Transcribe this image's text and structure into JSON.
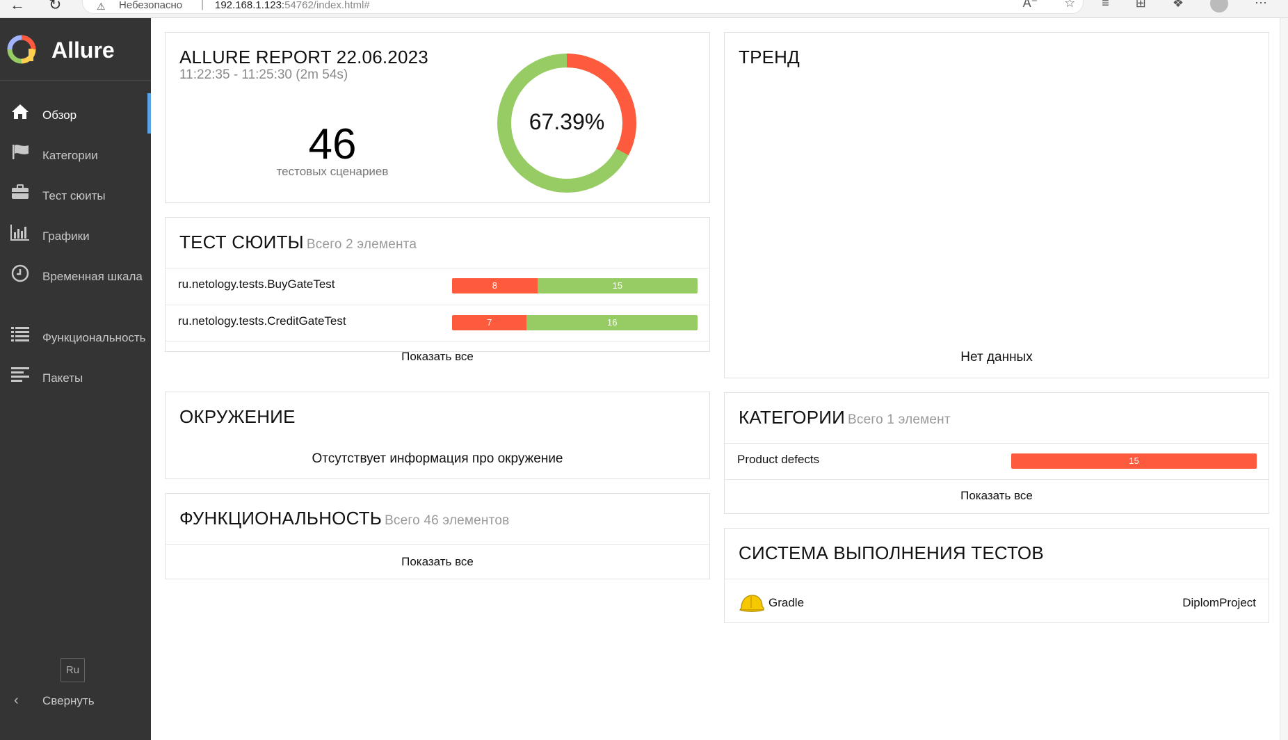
{
  "browser": {
    "insecure_label": "Небезопасно",
    "url_host": "192.168.1.123:",
    "url_tail": "54762/index.html#"
  },
  "sidebar": {
    "brand": "Allure",
    "items": [
      {
        "label": "Обзор",
        "icon": "home-icon"
      },
      {
        "label": "Категории",
        "icon": "flag-icon"
      },
      {
        "label": "Тест сюиты",
        "icon": "briefcase-icon"
      },
      {
        "label": "Графики",
        "icon": "bar-chart-icon"
      },
      {
        "label": "Временная шкала",
        "icon": "clock-icon"
      },
      {
        "label": "Функциональность",
        "icon": "list-icon"
      },
      {
        "label": "Пакеты",
        "icon": "align-left-icon"
      }
    ],
    "language": "Ru",
    "collapse_label": "Свернуть"
  },
  "summary": {
    "title": "ALLURE REPORT 22.06.2023",
    "time_range": "11:22:35 - 11:25:30 (2m 54s)",
    "total": "46",
    "total_label": "тестовых сценариев",
    "percent": "67.39%",
    "passed_fraction": 0.6739,
    "failed_fraction": 0.3261
  },
  "suites": {
    "title": "ТЕСТ СЮИТЫ",
    "count": "Всего 2 элемента",
    "items": [
      {
        "name": "ru.netology.tests.BuyGateTest",
        "failed": 8,
        "passed": 15
      },
      {
        "name": "ru.netology.tests.CreditGateTest",
        "failed": 7,
        "passed": 16
      }
    ],
    "show_all": "Показать все"
  },
  "environment": {
    "title": "ОКРУЖЕНИЕ",
    "empty": "Отсутствует информация про окружение"
  },
  "features": {
    "title": "ФУНКЦИОНАЛЬНОСТЬ",
    "count": "Всего 46 элементов",
    "show_all": "Показать все"
  },
  "trend": {
    "title": "ТРЕНД",
    "empty": "Нет данных"
  },
  "categories": {
    "title": "КАТЕГОРИИ",
    "count": "Всего 1 элемент",
    "items": [
      {
        "name": "Product defects",
        "value": 15
      }
    ],
    "show_all": "Показать все"
  },
  "executors": {
    "title": "СИСТЕМА ВЫПОЛНЕНИЯ ТЕСТОВ",
    "name": "Gradle",
    "build": "DiplomProject"
  },
  "colors": {
    "failed": "#fd5a3e",
    "passed": "#97cc64",
    "sidebar": "#343434",
    "active_marker": "#58a4e4"
  }
}
